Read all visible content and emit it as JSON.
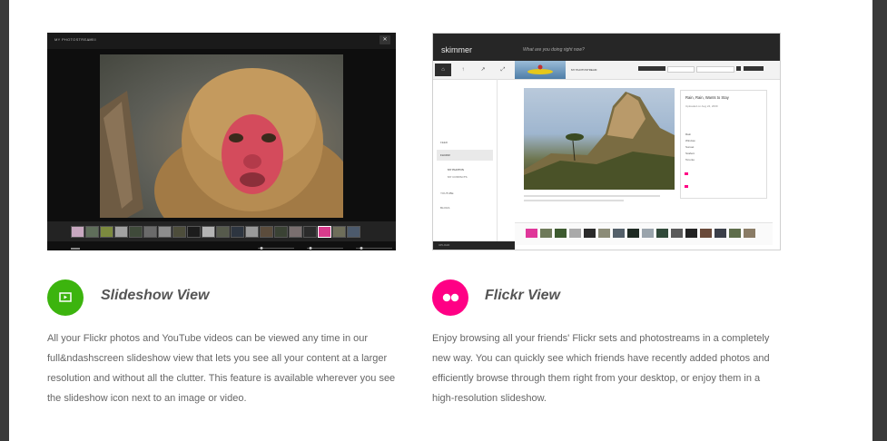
{
  "colors": {
    "slideshow_accent": "#3cb40e",
    "flickr_accent": "#ff0085",
    "frame": "#3a3a3a"
  },
  "slideshow_shot": {
    "title": "MY PHOTOSTREAM",
    "counter": "1 / 50",
    "close_icon": "close-icon"
  },
  "flickr_shot": {
    "brand": "skimmer",
    "prompt": "What are you doing right now?",
    "stream_label": "MY PHOTOSTREAM",
    "sidebar": [
      "FEED",
      "FLICKR",
      "MY PHOTOS",
      "MY CONTACTS",
      "YOUTUBE",
      "BLOGS"
    ],
    "info_title": "Rain, Rain, Wants to Stay",
    "info_sub": "Uploaded on Aug 24, 2009",
    "tags": [
      "Rain",
      "Window",
      "Sunset",
      "Scafeni",
      "Toronto"
    ],
    "bottom_label": "UPLOAD"
  },
  "features": [
    {
      "title": "Slideshow View",
      "icon": "slideshow-icon",
      "description": "All your Flickr photos and YouTube videos can be viewed any time in our full&ndashscreen slideshow view that lets you see all your content at a larger resolution and without all the clutter. This feature is available wherever you see the slideshow icon next to an image or video."
    },
    {
      "title": "Flickr View",
      "icon": "flickr-icon",
      "description": "Enjoy browsing all your friends' Flickr sets and photostreams in a completely new way. You can quickly see which friends have recently added photos and efficiently browse through them right from your desktop, or enjoy them in a high-resolution slideshow."
    }
  ]
}
